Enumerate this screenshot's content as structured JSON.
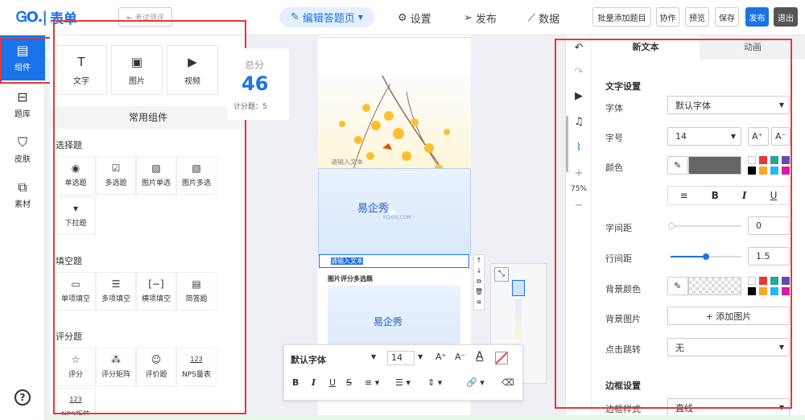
{
  "header": {
    "logo_mark": "ᏀO.|",
    "logo_name": "表单",
    "template_button": "⇤ 考试测评",
    "nav": {
      "edit": "编辑答题页",
      "settings": "设置",
      "publish": "发布",
      "data": "数据"
    },
    "buttons": {
      "bulk_add": "批量添加题目",
      "collab": "协作",
      "preview": "预览",
      "save": "保存",
      "publish": "发布",
      "exit": "退出"
    }
  },
  "sidebar": {
    "items": [
      {
        "label": "组件",
        "icon": "component-icon"
      },
      {
        "label": "题库",
        "icon": "inbox-icon"
      },
      {
        "label": "皮肤",
        "icon": "shirt-icon"
      },
      {
        "label": "素材",
        "icon": "material-icon"
      }
    ],
    "help_icon": "help-icon"
  },
  "panel": {
    "media": {
      "text": "文字",
      "image": "图片",
      "video": "视频"
    },
    "common_title": "常用组件",
    "sections": {
      "choice": {
        "title": "选择题",
        "items": [
          "单选题",
          "多选题",
          "图片单选",
          "图片多选",
          "下拉题"
        ]
      },
      "fill": {
        "title": "填空题",
        "items": [
          "单项填空",
          "多项填空",
          "横项填空",
          "简答题"
        ]
      },
      "rating": {
        "title": "评分题",
        "items": [
          "评分",
          "评分矩阵",
          "评价题",
          "NPS量表",
          "NPS矩阵"
        ]
      }
    }
  },
  "stats": {
    "total_label": "总分",
    "total_value": "46",
    "count_label": "计分题：5"
  },
  "canvas": {
    "placeholder1": "请输入文本",
    "placeholder2": "请输入文本",
    "question_title": "图片评分多选题",
    "watermark": "易企秀",
    "watermark_sub": "EQXIU.COM"
  },
  "text_toolbar": {
    "font": "默认字体",
    "size": "14"
  },
  "right": {
    "tabs": {
      "text": "新文本",
      "anim": "动画"
    },
    "zoom": "75%",
    "text_settings": "文字设置",
    "font_label": "字体",
    "font_value": "默认字体",
    "size_label": "字号",
    "size_value": "14",
    "color_label": "颜色",
    "letter_label": "字间距",
    "letter_value": "0",
    "line_label": "行间距",
    "line_value": "1.5",
    "bg_color_label": "背景颜色",
    "bg_image_label": "背景图片",
    "add_image": "+ 添加图片",
    "click_label": "点击跳转",
    "click_value": "无",
    "border_settings": "边框设置",
    "border_style_label": "边框样式",
    "border_style_value": "直线"
  },
  "colors": {
    "accent": "#1a73e8",
    "highlight": "#e53935",
    "text_color": "#666666"
  }
}
